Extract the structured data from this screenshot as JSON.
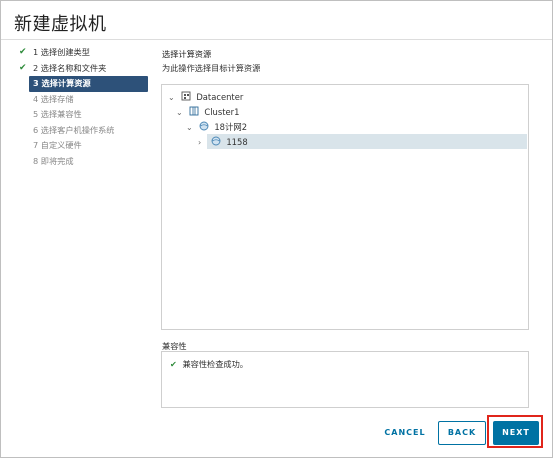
{
  "dialog": {
    "title": "新建虚拟机"
  },
  "steps": [
    {
      "label": "1 选择创建类型",
      "state": "done"
    },
    {
      "label": "2 选择名称和文件夹",
      "state": "done"
    },
    {
      "label": "3 选择计算资源",
      "state": "active"
    },
    {
      "label": "4 选择存储",
      "state": "pending"
    },
    {
      "label": "5 选择兼容性",
      "state": "pending"
    },
    {
      "label": "6 选择客户机操作系统",
      "state": "pending"
    },
    {
      "label": "7 自定义硬件",
      "state": "pending"
    },
    {
      "label": "8 即将完成",
      "state": "pending"
    }
  ],
  "section": {
    "title": "选择计算资源",
    "subtitle": "为此操作选择目标计算资源"
  },
  "tree": {
    "datacenter": "Datacenter",
    "cluster": "Cluster1",
    "pool": "18计网2",
    "selected": "1158"
  },
  "compatibility": {
    "label": "兼容性",
    "message": "兼容性检查成功。"
  },
  "buttons": {
    "cancel": "CANCEL",
    "back": "BACK",
    "next": "NEXT"
  },
  "colors": {
    "accent": "#0072a3",
    "active_step": "#2d5179",
    "highlight": "#e0251b",
    "success": "#2e8b3a"
  }
}
